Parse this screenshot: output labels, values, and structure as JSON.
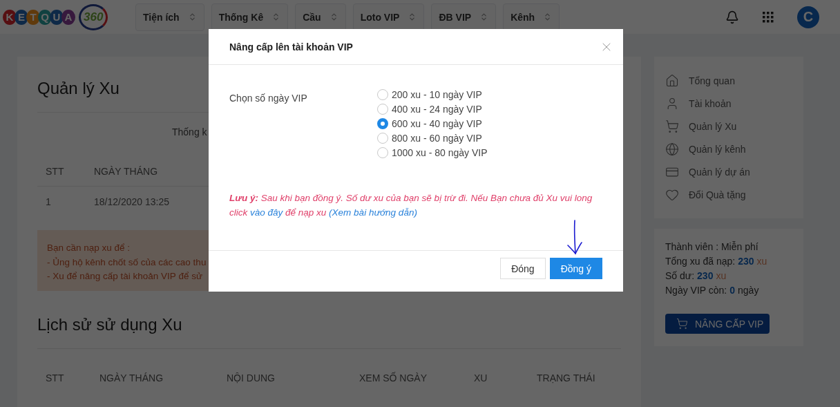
{
  "logo": {
    "letters": [
      "K",
      "E",
      "T",
      "Q",
      "U",
      "A"
    ],
    "number": "360"
  },
  "nav": [
    "Tiện ích",
    "Thống Kê",
    "Cầu",
    "Loto VIP",
    "ĐB VIP",
    "Kênh"
  ],
  "avatar": "C",
  "main": {
    "title": "Quản lý Xu",
    "stats_label": "Thống k",
    "table": {
      "columns": [
        "STT",
        "NGÀY THÁNG"
      ],
      "rows": [
        [
          "1",
          "18/12/2020 13:25"
        ]
      ]
    },
    "alert": [
      "Bạn cần nạp xu để :",
      "- Ủng hộ kênh chốt số của các cao thu",
      "- Xu để nâng cấp tài khoản VIP để sử"
    ],
    "history_title": "Lịch sử sử dụng Xu",
    "history_columns": [
      "STT",
      "NGÀY THÁNG",
      "NỘI DUNG",
      "XEM SỐ NGÀY",
      "XU",
      "TRẠNG THÁI"
    ]
  },
  "sidebar": {
    "items": [
      {
        "kind": "home",
        "label": "Tổng quan"
      },
      {
        "kind": "user",
        "label": "Tài khoản"
      },
      {
        "kind": "cart",
        "label": "Quản lý Xu"
      },
      {
        "kind": "globe",
        "label": "Quản lý kênh"
      },
      {
        "kind": "card",
        "label": "Quản lý dự án"
      },
      {
        "kind": "heart",
        "label": "Đổi Quà tặng"
      }
    ],
    "stats": [
      {
        "label": "Thành viên : Miễn phí"
      },
      {
        "label": "Tổng xu đã nạp:",
        "value": "230",
        "unit": "xu"
      },
      {
        "label": "Số dư:",
        "value": "230",
        "unit": "xu"
      },
      {
        "label": "Ngày VIP còn:",
        "value": "0",
        "unit": "ngày"
      }
    ],
    "upgrade_button": "NÂNG CẤP VIP"
  },
  "modal": {
    "title": "Nâng cấp lên tài khoản VIP",
    "field_label": "Chọn số ngày VIP",
    "options": [
      {
        "label": "200 xu - 10 ngày VIP",
        "selected": false
      },
      {
        "label": "400 xu - 24 ngày VIP",
        "selected": false
      },
      {
        "label": "600 xu - 40 ngày VIP",
        "selected": true
      },
      {
        "label": "800 xu - 60 ngày VIP",
        "selected": false
      },
      {
        "label": "1000 xu - 80 ngày VIP",
        "selected": false
      }
    ],
    "note": [
      {
        "kind": "label",
        "text": "Lưu ý:"
      },
      {
        "kind": "text",
        "text": " Sau khi bạn đồng ý. Số dư xu của bạn sẽ bị trừ đi. Nếu Bạn chưa đủ Xu vui long click "
      },
      {
        "kind": "link",
        "text": "vào đây"
      },
      {
        "kind": "text",
        "text": " để nạp xu "
      },
      {
        "kind": "link",
        "text": "(Xem bài hướng dẫn)"
      }
    ],
    "buttons": [
      {
        "kind": "secondary",
        "label": "Đóng"
      },
      {
        "kind": "primary",
        "label": "Đồng ý"
      }
    ]
  }
}
